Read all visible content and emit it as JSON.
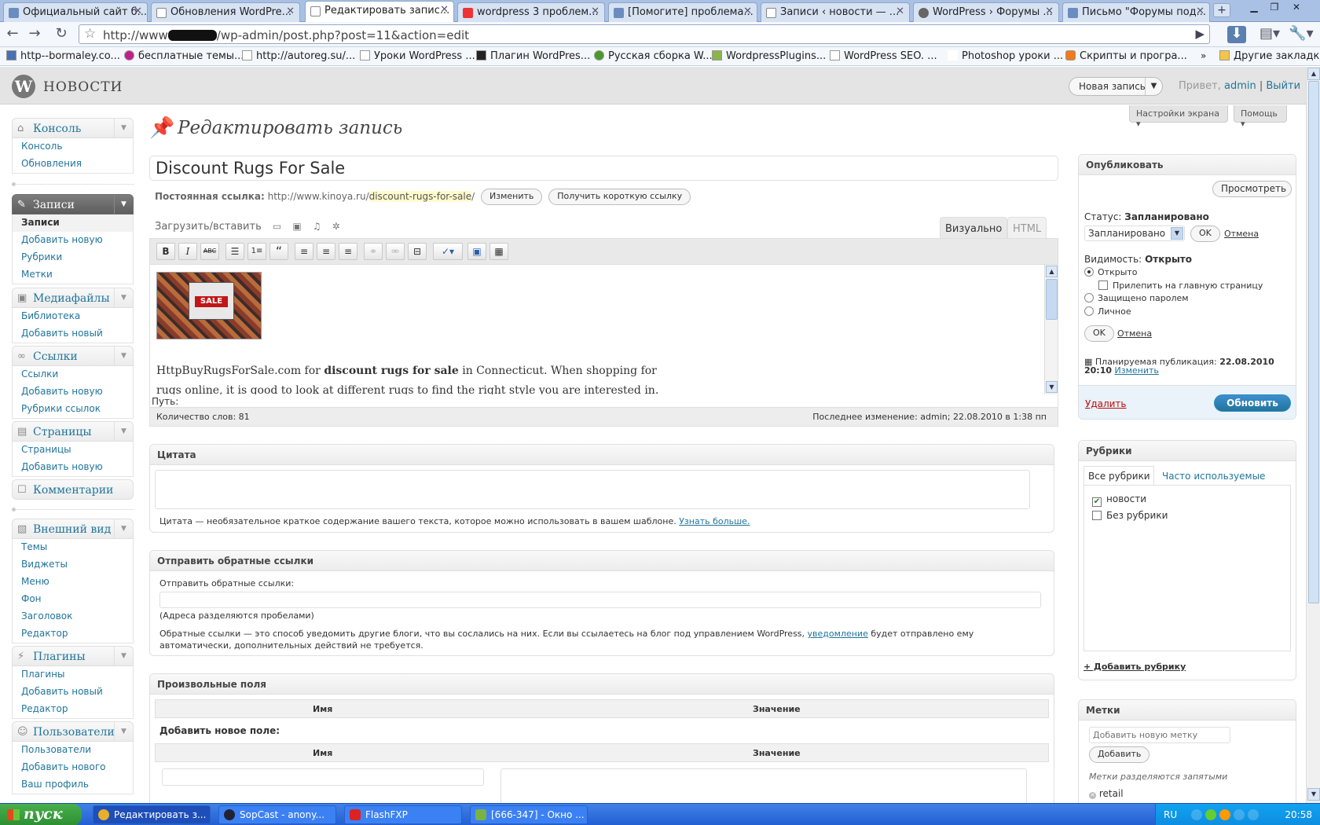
{
  "browser": {
    "tabs": [
      {
        "label": "Официальный сайт б..."
      },
      {
        "label": "Обновления WordPre..."
      },
      {
        "label": "Редактировать запис..."
      },
      {
        "label": "wordpress 3 проблем..."
      },
      {
        "label": "[Помогите] проблема..."
      },
      {
        "label": "Записи ‹ новости — ..."
      },
      {
        "label": "WordPress › Форумы ..."
      },
      {
        "label": "Письмо \"Форумы под..."
      }
    ],
    "url_prefix": "http://www",
    "url_suffix": "/wp-admin/post.php?post=11&action=edit",
    "bookmarks": [
      {
        "label": "http--bormaley.co..."
      },
      {
        "label": "бесплатные темы..."
      },
      {
        "label": "http://autoreg.su/..."
      },
      {
        "label": "Уроки WordPress ..."
      },
      {
        "label": "Плагин WordPres..."
      },
      {
        "label": "Русская сборка W..."
      },
      {
        "label": "WordpressPlugins..."
      },
      {
        "label": "WordPress SEO. ..."
      },
      {
        "label": "Photoshop уроки ..."
      },
      {
        "label": "Скрипты и програ..."
      }
    ],
    "other_bookmarks": "Другие закладки"
  },
  "wp_header": {
    "site_name": "НОВОСТИ",
    "new_post": "Новая запись",
    "greeting": "Привет,",
    "user": "admin",
    "separator": "|",
    "logout": "Выйти",
    "screen_options": "Настройки экрана",
    "help": "Помощь"
  },
  "menu": {
    "console": {
      "label": "Консоль",
      "items": [
        "Консоль",
        "Обновления"
      ]
    },
    "posts": {
      "label": "Записи",
      "items": [
        "Записи",
        "Добавить новую",
        "Рубрики",
        "Метки"
      ]
    },
    "media": {
      "label": "Медиафайлы",
      "items": [
        "Библиотека",
        "Добавить новый"
      ]
    },
    "links": {
      "label": "Ссылки",
      "items": [
        "Ссылки",
        "Добавить новую",
        "Рубрики ссылок"
      ]
    },
    "pages": {
      "label": "Страницы",
      "items": [
        "Страницы",
        "Добавить новую"
      ]
    },
    "comments": {
      "label": "Комментарии"
    },
    "appearance": {
      "label": "Внешний вид",
      "items": [
        "Темы",
        "Виджеты",
        "Меню",
        "Фон",
        "Заголовок",
        "Редактор"
      ]
    },
    "plugins": {
      "label": "Плагины",
      "items": [
        "Плагины",
        "Добавить новый",
        "Редактор"
      ]
    },
    "users": {
      "label": "Пользователи",
      "items": [
        "Пользователи",
        "Добавить нового",
        "Ваш профиль"
      ]
    }
  },
  "editor": {
    "page_title": "Редактировать запись",
    "post_title": "Discount Rugs For Sale",
    "permalink_label": "Постоянная ссылка:",
    "permalink_base": "http://www.kinoya.ru/",
    "permalink_slug": "discount-rugs-for-sale",
    "permalink_end": "/",
    "change_btn": "Изменить",
    "shortlink_btn": "Получить короткую ссылку",
    "upload_label": "Загрузить/вставить",
    "tab_visual": "Визуально",
    "tab_html": "HTML",
    "image_text": "SALE",
    "text_before": "HttpBuyRugsForSale.com for ",
    "text_bold": "discount rugs for sale",
    "text_after": " in Connecticut. When shopping for rugs online, it is good to look at different rugs to find the right style you are interested in.",
    "path_label": "Путь:",
    "word_count": "Количество слов: 81",
    "last_modified": "Последнее изменение: admin; 22.08.2010 в 1:38 пп"
  },
  "excerpt": {
    "title": "Цитата",
    "note": "Цитата — необязательное краткое содержание вашего текста, которое можно использовать в вашем шаблоне.",
    "learn_more": "Узнать больше."
  },
  "trackbacks": {
    "title": "Отправить обратные ссылки",
    "label": "Отправить обратные ссылки:",
    "hint": "(Адреса разделяются пробелами)",
    "note_before": "Обратные ссылки — это способ уведомить другие блоги, что вы сослались на них. Если вы ссылаетесь на блог под управлением WordPress,",
    "note_link": "уведомление",
    "note_after": "будет отправлено ему автоматически, дополнительных действий не требуется."
  },
  "custom_fields": {
    "title": "Произвольные поля",
    "col_name": "Имя",
    "col_value": "Значение",
    "add_new": "Добавить новое поле:"
  },
  "publish": {
    "title": "Опубликовать",
    "preview": "Просмотреть",
    "status_label": "Статус:",
    "status_value": "Запланировано",
    "status_select": "Запланировано",
    "ok": "OK",
    "cancel": "Отмена",
    "visibility_label": "Видимость:",
    "visibility_value": "Открыто",
    "opt_public": "Открыто",
    "opt_sticky": "Прилепить на главную страницу",
    "opt_password": "Защищено паролем",
    "opt_private": "Личное",
    "scheduled_label": "Планируемая публикация:",
    "scheduled_date": "22.08.2010",
    "scheduled_time": "20:10",
    "edit": "Изменить",
    "delete": "Удалить",
    "update": "Обновить"
  },
  "categories": {
    "title": "Рубрики",
    "tab_all": "Все рубрики",
    "tab_popular": "Часто используемые",
    "items": [
      {
        "label": "новости",
        "checked": true
      },
      {
        "label": "Без рубрики",
        "checked": false
      }
    ],
    "add": "+ Добавить рубрику"
  },
  "tags": {
    "title": "Метки",
    "placeholder": "Добавить новую метку",
    "add_btn": "Добавить",
    "hint": "Метки разделяются запятыми",
    "tag": "retail"
  },
  "taskbar": {
    "start": "пуск",
    "tasks": [
      {
        "label": "Редактировать з..."
      },
      {
        "label": "SopCast - anony..."
      },
      {
        "label": "FlashFXP"
      },
      {
        "label": "[666-347] - Окно ..."
      }
    ],
    "lang": "RU",
    "clock": "20:58"
  },
  "colors": {
    "wp_link": "#21759b",
    "update_button": "#21759b",
    "delete_link": "#bc0b0b"
  }
}
